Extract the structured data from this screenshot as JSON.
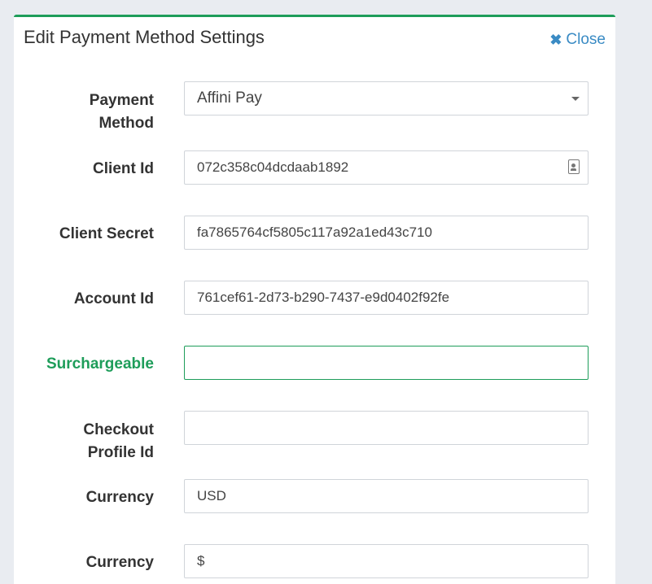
{
  "modal": {
    "title": "Edit Payment Method Settings",
    "close_label": "Close"
  },
  "form": {
    "payment_method": {
      "label": "Payment Method",
      "value": "Affini Pay"
    },
    "client_id": {
      "label": "Client Id",
      "value": "072c358c04dcdaab1892"
    },
    "client_secret": {
      "label": "Client Secret",
      "value": "fa7865764cf5805c117a92a1ed43c710"
    },
    "account_id": {
      "label": "Account Id",
      "value": "761cef61-2d73-b290-7437-e9d0402f92fe"
    },
    "surchargeable": {
      "label": "Surchargeable",
      "value": ""
    },
    "checkout_profile_id": {
      "label": "Checkout Profile Id",
      "value": ""
    },
    "currency": {
      "label": "Currency",
      "value": "USD"
    },
    "currency_symbol": {
      "label": "Currency",
      "value": "$"
    }
  },
  "colors": {
    "accent_green": "#1e9d5a",
    "link_blue": "#3a8bc4"
  }
}
